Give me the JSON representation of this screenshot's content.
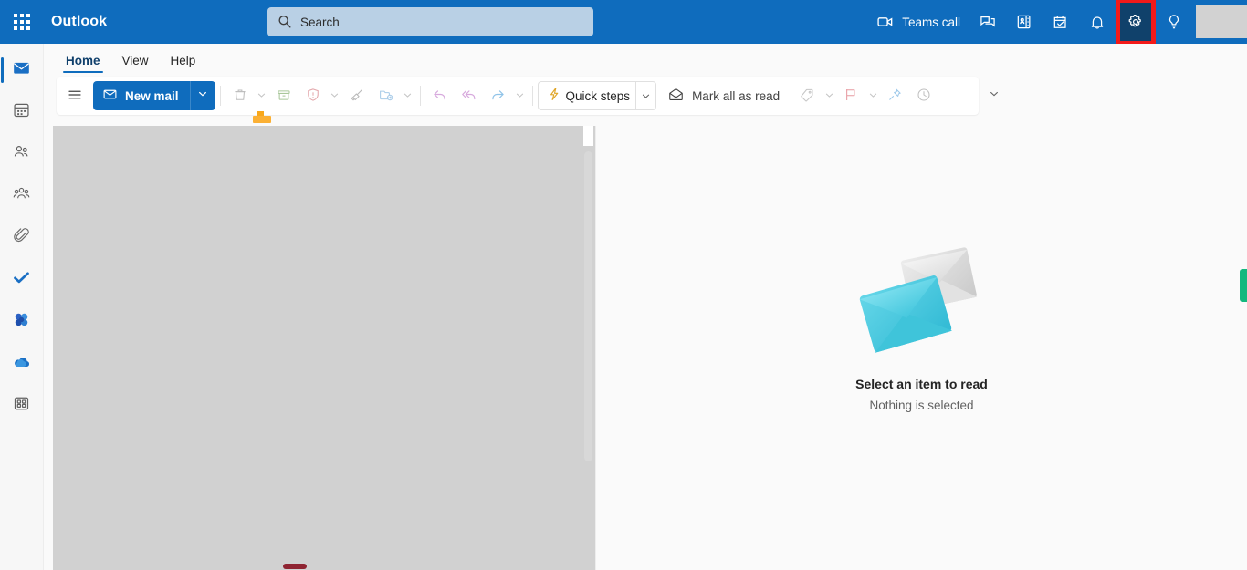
{
  "topbar": {
    "app_launcher": "app-launcher",
    "brand": "Outlook",
    "background_color": "#0f6cbd",
    "search": {
      "placeholder": "Search",
      "value": ""
    },
    "actions": [
      {
        "name": "teams-call",
        "label": "Teams call",
        "icon": "video-camera-icon"
      },
      {
        "name": "chat",
        "label": "",
        "icon": "chat-icon"
      },
      {
        "name": "contacts-card",
        "label": "",
        "icon": "contact-card-icon"
      },
      {
        "name": "to-do",
        "label": "",
        "icon": "calendar-check-icon"
      },
      {
        "name": "notifications",
        "label": "",
        "icon": "bell-icon"
      },
      {
        "name": "settings",
        "label": "",
        "icon": "gear-icon",
        "highlighted": true,
        "highlight_color": "#f31a1a"
      },
      {
        "name": "tips",
        "label": "",
        "icon": "lightbulb-icon"
      }
    ],
    "account_tile": ""
  },
  "rail": {
    "items": [
      {
        "name": "mail",
        "icon": "mail-icon",
        "active": true
      },
      {
        "name": "calendar",
        "icon": "calendar-icon",
        "active": false
      },
      {
        "name": "people",
        "icon": "people-icon",
        "active": false
      },
      {
        "name": "groups",
        "icon": "groups-icon",
        "active": false
      },
      {
        "name": "files",
        "icon": "paperclip-icon",
        "active": false
      },
      {
        "name": "to-do",
        "icon": "checkmark-icon",
        "active": false
      },
      {
        "name": "loop",
        "icon": "loop-icon",
        "active": false
      },
      {
        "name": "onedrive",
        "icon": "cloud-icon",
        "active": false
      },
      {
        "name": "apps",
        "icon": "apps-grid-icon",
        "active": false
      }
    ]
  },
  "ribbon": {
    "tabs": [
      {
        "label": "Home",
        "active": true
      },
      {
        "label": "View",
        "active": false
      },
      {
        "label": "Help",
        "active": false
      }
    ],
    "hamburger": "hamburger-icon",
    "new_mail": {
      "label": "New mail",
      "icon": "envelope-icon"
    },
    "commands": [
      {
        "name": "delete",
        "icon": "trash-icon",
        "caret": true
      },
      {
        "name": "archive",
        "icon": "archive-icon",
        "caret": false
      },
      {
        "name": "report",
        "icon": "shield-icon",
        "caret": true
      },
      {
        "name": "sweep",
        "icon": "broom-icon",
        "caret": false
      },
      {
        "name": "move-to",
        "icon": "move-folder-icon",
        "caret": true
      }
    ],
    "reply_group": [
      {
        "name": "reply",
        "icon": "reply-icon"
      },
      {
        "name": "reply-all",
        "icon": "reply-all-icon"
      },
      {
        "name": "forward",
        "icon": "forward-icon",
        "caret": true
      }
    ],
    "quick_steps": {
      "label": "Quick steps",
      "icon": "lightning-icon"
    },
    "mark_all_read": {
      "label": "Mark all as read",
      "icon": "open-envelope-icon"
    },
    "trailing": [
      {
        "name": "categorize",
        "icon": "tag-icon",
        "caret": true
      },
      {
        "name": "flag",
        "icon": "flag-icon",
        "caret": true
      },
      {
        "name": "pin",
        "icon": "pin-icon",
        "caret": false
      },
      {
        "name": "snooze",
        "icon": "clock-icon",
        "caret": false
      }
    ],
    "overflow": "chevron-down-icon"
  },
  "reading_pane": {
    "illustration": "two-envelopes-illustration",
    "title": "Select an item to read",
    "subtitle": "Nothing is selected"
  },
  "message_list": {
    "state": "placeholder",
    "placeholder_color": "#d1d1d1"
  }
}
